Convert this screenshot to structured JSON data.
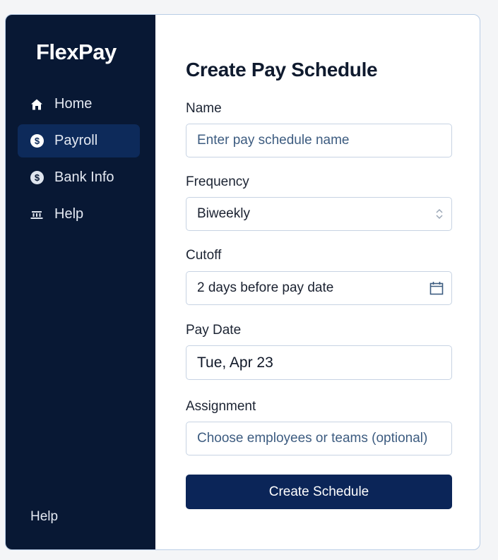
{
  "app": {
    "brand": "FlexPay"
  },
  "sidebar": {
    "items": [
      {
        "label": "Home",
        "icon": "home-icon",
        "active": false
      },
      {
        "label": "Payroll",
        "icon": "dollar-circle-icon",
        "active": true
      },
      {
        "label": "Bank Info",
        "icon": "dollar-circle-icon",
        "active": false
      },
      {
        "label": "Help",
        "icon": "bank-icon",
        "active": false
      }
    ],
    "footer_help": "Help"
  },
  "form": {
    "title": "Create Pay Schedule",
    "name": {
      "label": "Name",
      "placeholder": "Enter pay schedule name",
      "value": ""
    },
    "frequency": {
      "label": "Frequency",
      "value": "Biweekly"
    },
    "cutoff": {
      "label": "Cutoff",
      "value": "2 days before pay date"
    },
    "pay_date": {
      "label": "Pay Date",
      "value": "Tue, Apr 23"
    },
    "assignment": {
      "label": "Assignment",
      "placeholder": "Choose employees or teams (optional)",
      "value": ""
    },
    "submit_label": "Create Schedule"
  },
  "colors": {
    "sidebar_bg": "#081834",
    "active_item_bg": "#0d2a5a",
    "primary_button": "#0b2558",
    "window_border": "#b9cde6"
  }
}
